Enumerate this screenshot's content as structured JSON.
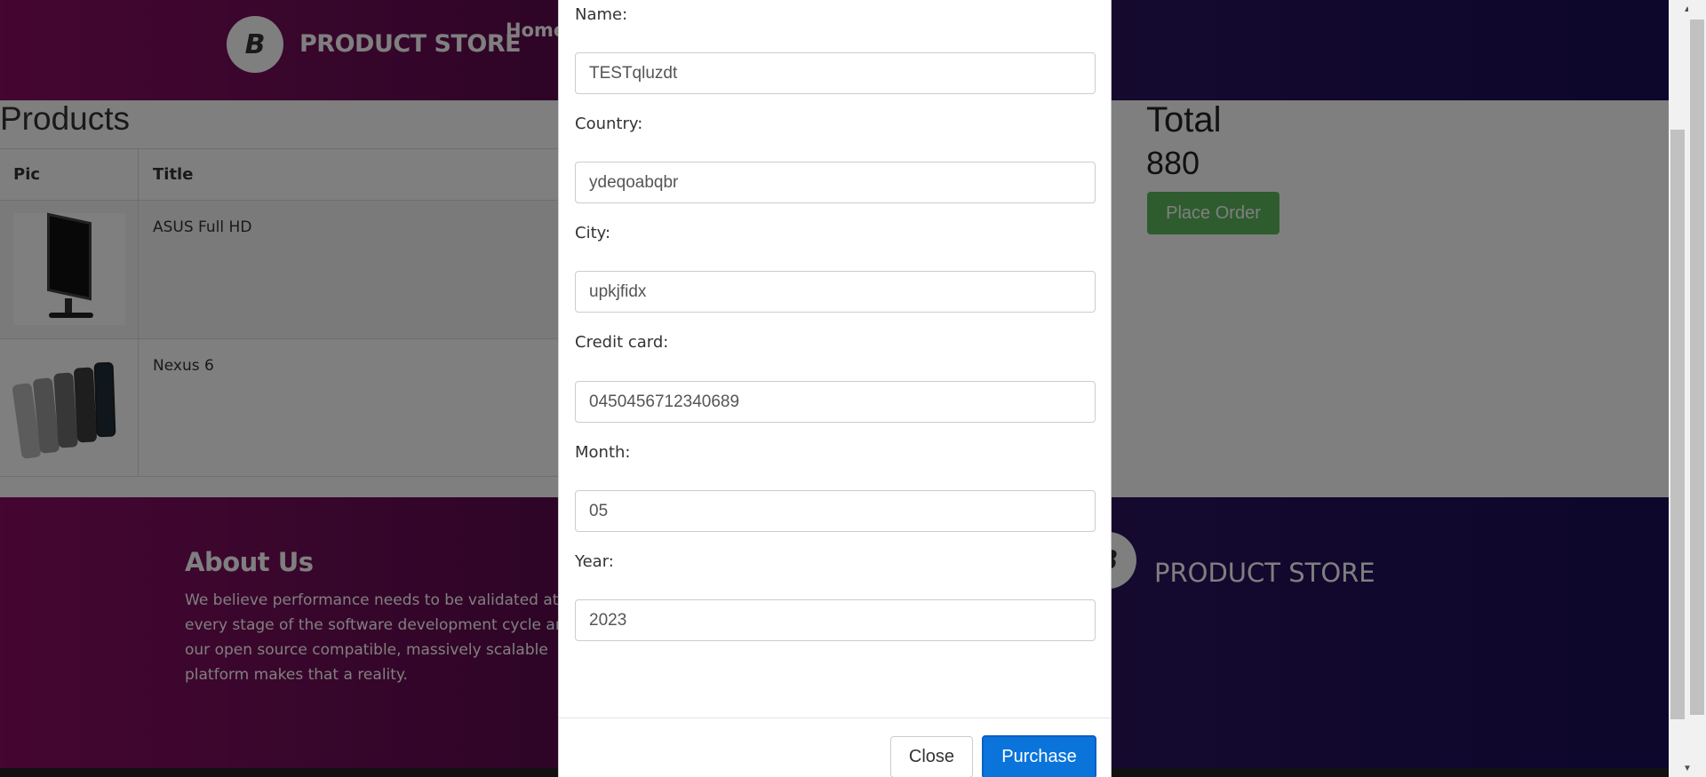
{
  "navbar": {
    "brand_logo_letter": "B",
    "brand_name": "PRODUCT STORE",
    "home_label": "Home"
  },
  "cart": {
    "title": "Products",
    "columns": [
      "Pic",
      "Title"
    ],
    "rows": [
      {
        "title": "ASUS Full HD",
        "image_icon": "monitor-image"
      },
      {
        "title": "Nexus 6",
        "image_icon": "phones-image"
      }
    ],
    "total_label": "Total",
    "total_value": "880",
    "place_order_label": "Place Order"
  },
  "footer": {
    "about_title": "About Us",
    "about_text": "We believe performance needs to be validated at every stage of the software development cycle and our open source compatible, massively scalable platform makes that a reality.",
    "brand_logo_letter": "B",
    "brand_name": "PRODUCT STORE"
  },
  "order_modal": {
    "fields": [
      {
        "label": "Name:",
        "value": "TESTqluzdt"
      },
      {
        "label": "Country:",
        "value": "ydeqoabqbr"
      },
      {
        "label": "City:",
        "value": "upkjfidx"
      },
      {
        "label": "Credit card:",
        "value": "0450456712340689"
      },
      {
        "label": "Month:",
        "value": "05"
      },
      {
        "label": "Year:",
        "value": "2023"
      }
    ],
    "close_label": "Close",
    "purchase_label": "Purchase"
  },
  "colors": {
    "brand_gradient_start": "#8a0c63",
    "brand_gradient_end": "#1b0e58",
    "place_order": "#5cb85c",
    "purchase": "#0a74da"
  }
}
